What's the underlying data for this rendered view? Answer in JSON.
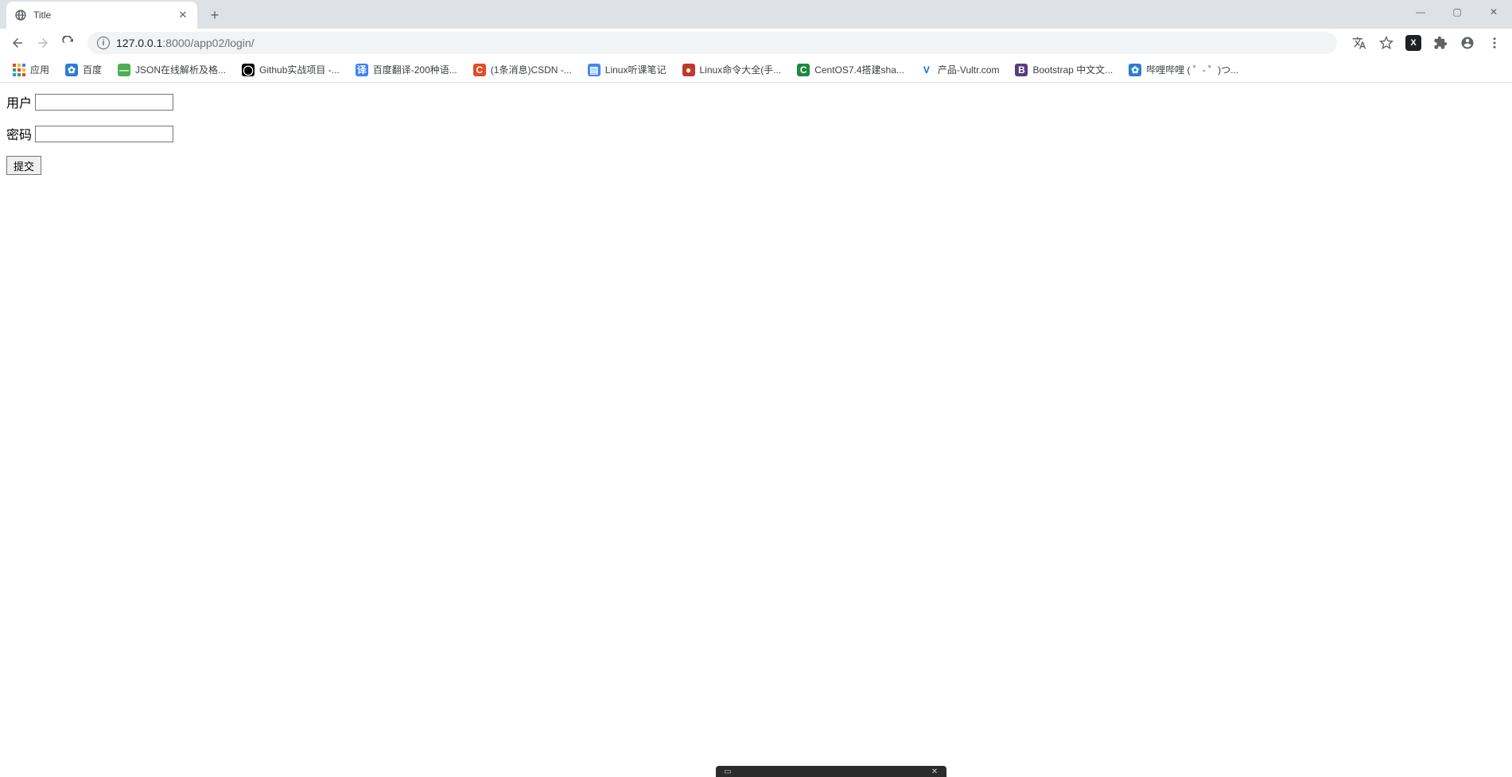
{
  "window": {
    "tab_title": "Title",
    "minimize": "—",
    "maximize": "▢",
    "close": "✕"
  },
  "nav": {
    "url_host": "127.0.0.1",
    "url_port": ":8000",
    "url_path": "/app02/login/"
  },
  "bookmarks": {
    "apps": "应用",
    "items": [
      {
        "label": "百度",
        "icon_bg": "#2b7cd3",
        "icon_fg": "#fff",
        "icon_text": "✿"
      },
      {
        "label": "JSON在线解析及格...",
        "icon_bg": "#4caf50",
        "icon_fg": "#fff",
        "icon_text": "—"
      },
      {
        "label": "Github实战项目 -...",
        "icon_bg": "#000000",
        "icon_fg": "#fff",
        "icon_text": "◯"
      },
      {
        "label": "百度翻译-200种语...",
        "icon_bg": "#3b82f6",
        "icon_fg": "#fff",
        "icon_text": "译"
      },
      {
        "label": "(1条消息)CSDN -...",
        "icon_bg": "#e34c26",
        "icon_fg": "#fff",
        "icon_text": "C"
      },
      {
        "label": "Linux听课笔记",
        "icon_bg": "#4285f4",
        "icon_fg": "#fff",
        "icon_text": "▤"
      },
      {
        "label": "Linux命令大全(手...",
        "icon_bg": "#c0392b",
        "icon_fg": "#fff",
        "icon_text": "●"
      },
      {
        "label": "CentOS7.4搭建sha...",
        "icon_bg": "#1b8a3f",
        "icon_fg": "#fff",
        "icon_text": "C"
      },
      {
        "label": "产品-Vultr.com",
        "icon_bg": "#ffffff",
        "icon_fg": "#0069ff",
        "icon_text": "V"
      },
      {
        "label": "Bootstrap 中文文...",
        "icon_bg": "#563d7c",
        "icon_fg": "#fff",
        "icon_text": "B"
      },
      {
        "label": "哔哩哔哩 ( ゜- ゜)つ...",
        "icon_bg": "#2b7cd3",
        "icon_fg": "#fff",
        "icon_text": "✿"
      }
    ]
  },
  "form": {
    "user_label": "用户",
    "password_label": "密码",
    "submit_label": "提交",
    "user_value": "",
    "password_value": ""
  }
}
